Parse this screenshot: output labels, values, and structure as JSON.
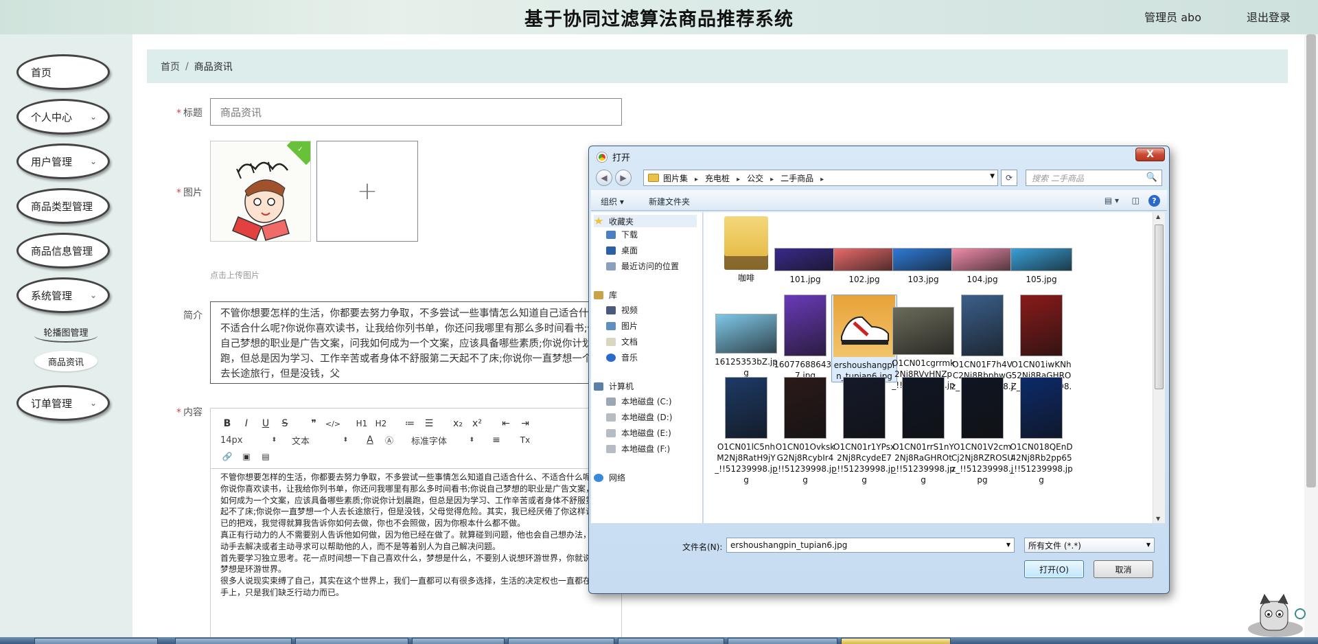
{
  "header": {
    "title": "基于协同过滤算法商品推荐系统",
    "admin": "管理员 abo",
    "logout": "退出登录"
  },
  "sidebar": {
    "items": [
      {
        "label": "首页",
        "has_chevron": false
      },
      {
        "label": "个人中心",
        "has_chevron": true
      },
      {
        "label": "用户管理",
        "has_chevron": true
      },
      {
        "label": "商品类型管理",
        "has_chevron": true
      },
      {
        "label": "商品信息管理",
        "has_chevron": true
      },
      {
        "label": "系统管理",
        "has_chevron": true
      },
      {
        "label": "订单管理",
        "has_chevron": true
      }
    ],
    "sub_items": [
      {
        "label": "轮播图管理"
      },
      {
        "label": "商品资讯"
      }
    ],
    "chevron": "⌄"
  },
  "breadcrumb": {
    "home": "首页",
    "separator": "/",
    "current": "商品资讯"
  },
  "form": {
    "required_mark": "*",
    "title_label": "标题",
    "title_value": "商品资讯",
    "image_label": "图片",
    "upload_plus": "+",
    "upload_hint": "点击上传图片",
    "intro_label": "简介",
    "intro_text": "不管你想要怎样的生活，你都要去努力争取，不多尝试一些事情怎么知道自己适合什么、不适合什么呢?你说你喜欢读书，让我给你列书单，你还问我哪里有那么多时间看书;你说自己梦想的职业是广告文案，问我如何成为一个文案，应该具备哪些素质;你说你计划晨跑，但总是因为学习、工作辛苦或者身体不舒服第二天起不了床;你说你一直梦想一个人去长途旅行，但是没钱，父",
    "content_label": "内容"
  },
  "editor": {
    "toolbar_row1": [
      "B",
      "I",
      "U",
      "S",
      "❞",
      "</>",
      "H1",
      "H2",
      "≔",
      "☰",
      "x₂",
      "x²",
      "⇤",
      "⇥"
    ],
    "font_size": "14px",
    "text_style": "文本",
    "font_family": "标准字体",
    "toolbar_row2_icons": [
      "A",
      "Ⓐ",
      "≡",
      "Tx"
    ],
    "toolbar_row3": [
      "🔗",
      "▣",
      "▤"
    ],
    "content": [
      "不管你想要怎样的生活，你都要去努力争取，不多尝试一些事情怎么知道自己适合什么、不适合什么呢?",
      "你说你喜欢读书，让我给你列书单，你还问我哪里有那么多时间看书;你说自己梦想的职业是广告文案，问我如何成为一个文案，应该具备哪些素质;你说你计划晨跑，但总是因为学习、工作辛苦或者身体不舒服第二天起不了床;你说你一直梦想一个人去长途旅行，但是没钱，父母觉得危险。其实，我已经厌倦了你这样说说而已的把戏，我觉得就算我告诉你如何去做，你也不会照做，因为你根本什么都不做。",
      "真正有行动力的人不需要别人告诉他如何做，因为他已经在做了。就算碰到问题，他也会自己想办法，自己动手去解决或者主动寻求可以帮助他的人，而不是等着别人为自己解决问题。",
      "首先要学习独立思考。花一点时间想一下自己喜欢什么，梦想是什么，不要别人说想环游世界，你就说你的梦想是环游世界。",
      "很多人说现实束缚了自己，其实在这个世界上，我们一直都可以有很多选择，生活的决定权也一直都在自己手上，只是我们缺乏行动力而已。"
    ]
  },
  "dialog": {
    "title": "打开",
    "close": "X",
    "back": "◀",
    "forward": "▶",
    "path": [
      "图片集",
      "充电桩",
      "公交",
      "二手商品"
    ],
    "refresh_icon": "⟳",
    "search_placeholder": "搜索 二手商品",
    "search_icon": "🔍",
    "organize": "组织 ▾",
    "new_folder": "新建文件夹",
    "view_icon": "▤ ▾",
    "pane_icon": "◫",
    "help_icon": "?",
    "nav": {
      "favorites": "收藏夹",
      "fav_items": [
        "下载",
        "桌面",
        "最近访问的位置"
      ],
      "library": "库",
      "lib_items": [
        "视频",
        "图片",
        "文档",
        "音乐"
      ],
      "computer": "计算机",
      "drives": [
        "本地磁盘 (C:)",
        "本地磁盘 (D:)",
        "本地磁盘 (E:)",
        "本地磁盘 (F:)"
      ],
      "network": "网络"
    },
    "files": [
      {
        "name": "咖啡",
        "kind": "folder"
      },
      {
        "name": "101.jpg",
        "kind": "banner",
        "color": "#3a2a8a"
      },
      {
        "name": "102.jpg",
        "kind": "banner",
        "color": "#e86a6a"
      },
      {
        "name": "103.jpg",
        "kind": "banner",
        "color": "#2f7ad6"
      },
      {
        "name": "104.jpg",
        "kind": "banner",
        "color": "#f08caa"
      },
      {
        "name": "105.jpg",
        "kind": "banner",
        "color": "#3aa0d8"
      },
      {
        "name": "16125353bZ.jpg",
        "kind": "landscape",
        "color": "#7fc8e8"
      },
      {
        "name": "1607768864307.jpg",
        "kind": "phone",
        "color": "#6a3ab8"
      },
      {
        "name": "ershoushangpin_tupian6.jpg",
        "kind": "shoe",
        "color": "#e8a23a",
        "selected": true
      },
      {
        "name": "O1CN01cgrrmk2Nj8RVyHNZp_!!51239998.jpg",
        "kind": "photo",
        "color": "#6b6b5b"
      },
      {
        "name": "O1CN01F7h4VC2Nj8RbphwGz_!!51239998.jpg",
        "kind": "laptop",
        "color": "#3b5f8a"
      },
      {
        "name": "O1CN01iwKNh52Nj8RaGHROZ_!!51239998.jpg",
        "kind": "poster",
        "color": "#8a1a1a"
      },
      {
        "name": "O1CN01lC5nhM2Nj8RatH9jY_!!51239998.jpg",
        "kind": "tall",
        "color": "#1d3a66"
      },
      {
        "name": "O1CN01OvkskG2Nj8RcybIr4_!!51239998.jpg",
        "kind": "tall",
        "color": "#2a1a1a"
      },
      {
        "name": "O1CN01r1YPsx2Nj8RcydeE7_!!51239998.jpg",
        "kind": "tall",
        "color": "#151a2a"
      },
      {
        "name": "O1CN01rrS1nY2Nj8RaGHROt_!!51239998.jpg",
        "kind": "tall",
        "color": "#0f1624"
      },
      {
        "name": "O1CN01V2cmCj2Nj8RZROSUz_!!51239998.jpg",
        "kind": "tall",
        "color": "#101522"
      },
      {
        "name": "O1CN018QEnD42Nj8Rb2pp65_!!51239998.jpg",
        "kind": "tall",
        "color": "#0c2a6a"
      }
    ],
    "filename_label": "文件名(N):",
    "filename_value": "ershoushangpin_tupian6.jpg",
    "filetype": "所有文件 (*.*)",
    "open_button": "打开(O)",
    "cancel_button": "取消"
  }
}
